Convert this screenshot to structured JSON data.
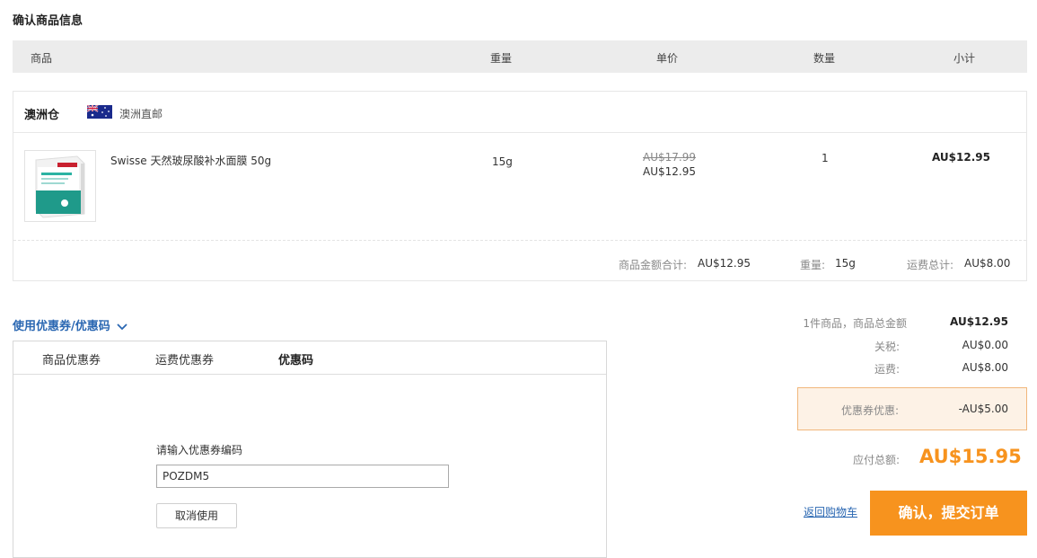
{
  "section_title": "确认商品信息",
  "table_headers": {
    "product": "商品",
    "weight": "重量",
    "unit_price": "单价",
    "quantity": "数量",
    "subtotal": "小计"
  },
  "warehouse": {
    "name": "澳洲仓",
    "flag": "australia-flag-icon",
    "shipping": "澳洲直邮"
  },
  "item": {
    "image": "product-image",
    "name": "Swisse 天然玻尿酸补水面膜 50g",
    "weight": "15g",
    "original_price": "AU$17.99",
    "price": "AU$12.95",
    "quantity": "1",
    "subtotal": "AU$12.95"
  },
  "order_summary": {
    "goods_total_label": "商品金额合计:",
    "goods_total_value": "AU$12.95",
    "weight_label": "重量:",
    "weight_value": "15g",
    "shipping_label": "运费总计:",
    "shipping_value": "AU$8.00"
  },
  "coupon": {
    "toggle_label": "使用优惠券/优惠码",
    "tabs": [
      "商品优惠券",
      "运费优惠券",
      "优惠码"
    ],
    "active_tab": "优惠码",
    "code_label": "请输入优惠券编码",
    "code_value": "POZDM5",
    "cancel_label": "取消使用"
  },
  "totals": {
    "goods_label": "1件商品，商品总金额",
    "goods_value": "AU$12.95",
    "tax_label": "关税:",
    "tax_value": "AU$0.00",
    "shipping_label": "运费:",
    "shipping_value": "AU$8.00",
    "discount_label": "优惠券优惠:",
    "discount_value": "-AU$5.00",
    "payable_label": "应付总额:",
    "payable_value": "AU$15.95"
  },
  "actions": {
    "back_label": "返回购物车",
    "submit_label": "确认，提交订单"
  },
  "colors": {
    "accent": "#f7931e",
    "link": "#2a67b2",
    "discount_bg": "#fdf2e6"
  }
}
